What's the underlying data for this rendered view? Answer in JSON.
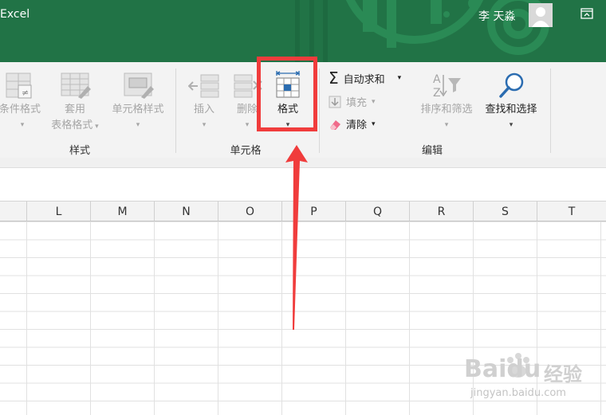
{
  "titlebar": {
    "app_title": "Excel",
    "user_name": "李 天淼",
    "bg_color": "#217346"
  },
  "ribbon": {
    "styles": {
      "conditional_format": "条件格式",
      "table_format_line1": "套用",
      "table_format_line2": "表格格式",
      "cell_styles": "单元格样式",
      "group_label": "样式"
    },
    "cells": {
      "insert": "插入",
      "delete": "删除",
      "format": "格式",
      "group_label": "单元格"
    },
    "editing": {
      "autosum": "自动求和",
      "fill": "填充",
      "clear": "清除",
      "sort_filter": "排序和筛选",
      "find_select": "查找和选择",
      "group_label": "编辑"
    }
  },
  "columns": [
    "L",
    "M",
    "N",
    "O",
    "P",
    "Q",
    "R",
    "S",
    "T"
  ],
  "watermark": {
    "brand": "Baidu",
    "sub": "经验",
    "url": "jingyan.baidu.com"
  },
  "annotation": {
    "color": "#f03c3c"
  }
}
